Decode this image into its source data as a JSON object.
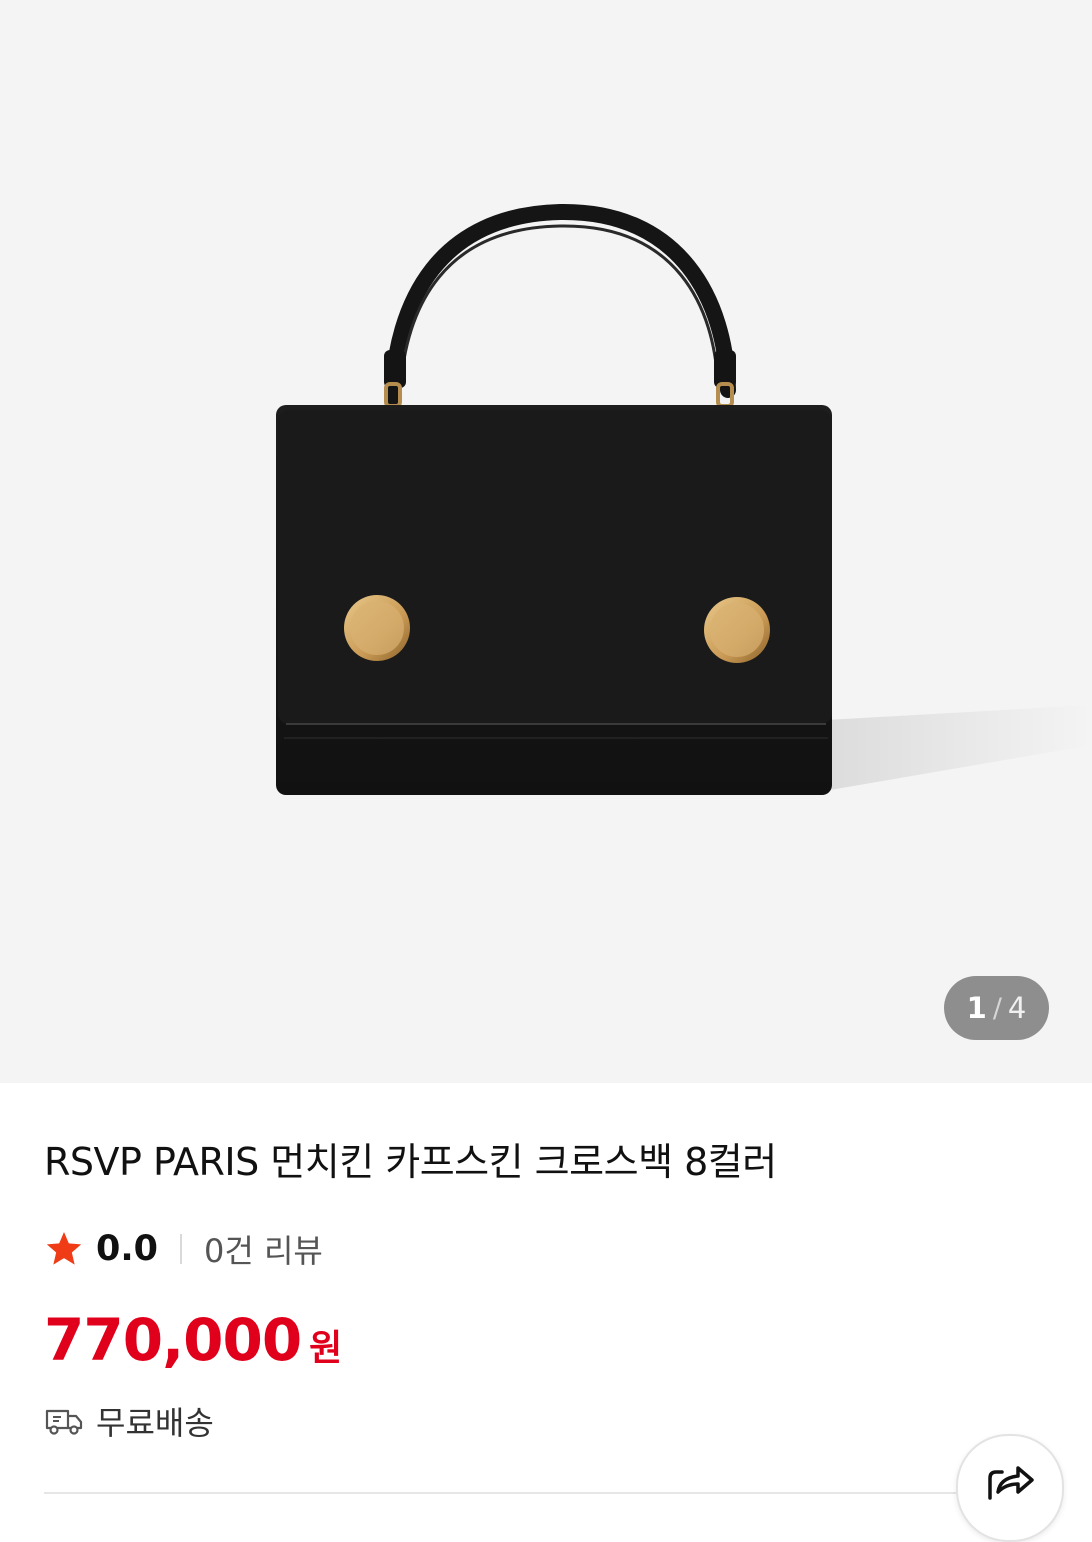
{
  "gallery": {
    "image_alt": "RSVP PARIS black crossbody bag",
    "current": "1",
    "separator": "/",
    "total": "4"
  },
  "product": {
    "title": "RSVP PARIS 먼치킨 카프스킨 크로스백 8컬러",
    "rating": "0.0",
    "review_count": "0건 리뷰",
    "price": "770,000",
    "currency": "원",
    "shipping": "무료배송"
  },
  "icons": {
    "rating": "star-icon",
    "shipping": "truck-icon",
    "share": "share-icon"
  },
  "colors": {
    "price": "#e1001b",
    "star": "#f03c16",
    "background": "#f4f4f4"
  }
}
